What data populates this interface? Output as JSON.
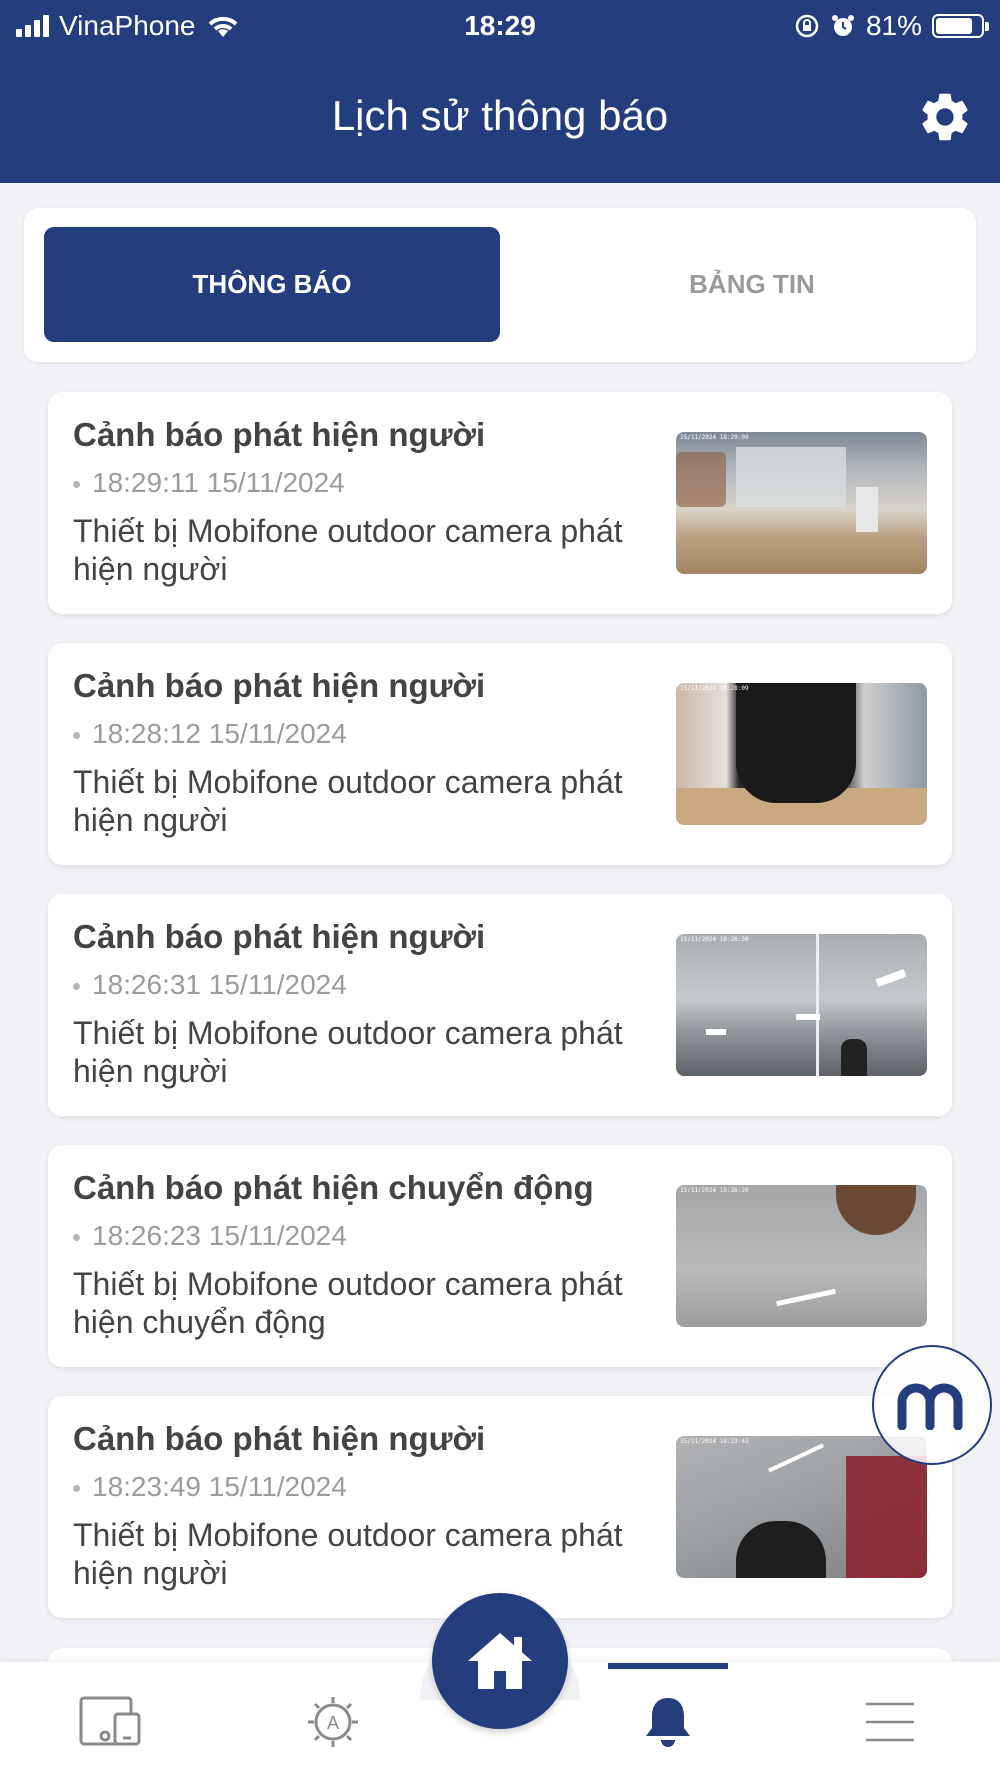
{
  "status_bar": {
    "carrier": "VinaPhone",
    "time": "18:29",
    "battery": "81%",
    "battery_level": 0.81
  },
  "header": {
    "title": "Lịch sử thông báo",
    "settings_icon": "gear-icon"
  },
  "tabs": [
    {
      "label": "THÔNG BÁO",
      "active": true
    },
    {
      "label": "BẢNG TIN",
      "active": false
    }
  ],
  "notifications": [
    {
      "title": "Cảnh báo phát hiện người",
      "time": "18:29:11 15/11/2024",
      "description": "Thiết bị Mobifone outdoor camera phát hiện người",
      "thumb_ts": "15/11/2024 18:29:09"
    },
    {
      "title": "Cảnh báo phát hiện người",
      "time": "18:28:12 15/11/2024",
      "description": "Thiết bị Mobifone outdoor camera phát hiện người",
      "thumb_ts": "15/11/2024 18:28:09"
    },
    {
      "title": "Cảnh báo phát hiện người",
      "time": "18:26:31 15/11/2024",
      "description": "Thiết bị Mobifone outdoor camera phát hiện người",
      "thumb_ts": "15/11/2024 18:26:30"
    },
    {
      "title": "Cảnh báo phát hiện chuyển động",
      "time": "18:26:23 15/11/2024",
      "description": "Thiết bị Mobifone outdoor camera phát hiện chuyển động",
      "thumb_ts": "15/11/2024 18:26:20"
    },
    {
      "title": "Cảnh báo phát hiện người",
      "time": "18:23:49 15/11/2024",
      "description": "Thiết bị Mobifone outdoor camera phát hiện người",
      "thumb_ts": "15/11/2024 18:23:43"
    }
  ],
  "bottom_nav": [
    {
      "icon": "devices-icon",
      "active": false
    },
    {
      "icon": "automation-icon",
      "active": false
    },
    {
      "icon": "home-icon",
      "active": false
    },
    {
      "icon": "bell-icon",
      "active": true
    },
    {
      "icon": "menu-icon",
      "active": false
    }
  ],
  "colors": {
    "primary": "#243d7c",
    "background": "#f1f2f6",
    "muted": "#9b9b9b"
  }
}
